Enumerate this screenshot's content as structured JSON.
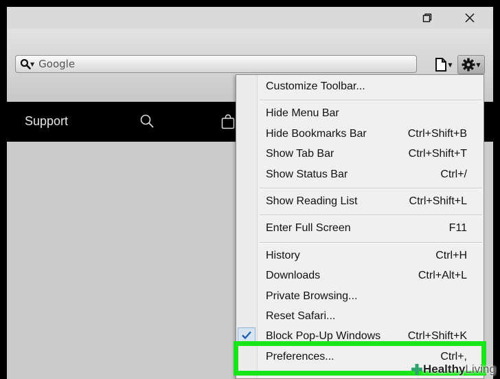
{
  "window": {
    "controls": {
      "restore_glyph": "❐",
      "close_glyph": "✕"
    }
  },
  "search": {
    "placeholder": "Google",
    "engine_icon": "search-icon"
  },
  "toolbar": {
    "page_icon": "page-icon",
    "settings_icon": "gear-icon"
  },
  "site_nav": {
    "support_label": "Support",
    "search_icon": "search-icon",
    "bag_icon": "shopping-bag-icon"
  },
  "menu": {
    "groups": [
      [
        {
          "label": "Customize Toolbar...",
          "shortcut": ""
        }
      ],
      [
        {
          "label": "Hide Menu Bar",
          "shortcut": ""
        },
        {
          "label": "Hide Bookmarks Bar",
          "shortcut": "Ctrl+Shift+B"
        },
        {
          "label": "Show Tab Bar",
          "shortcut": "Ctrl+Shift+T"
        },
        {
          "label": "Show Status Bar",
          "shortcut": "Ctrl+/"
        }
      ],
      [
        {
          "label": "Show Reading List",
          "shortcut": "Ctrl+Shift+L"
        }
      ],
      [
        {
          "label": "Enter Full Screen",
          "shortcut": "F11"
        }
      ],
      [
        {
          "label": "History",
          "shortcut": "Ctrl+H"
        },
        {
          "label": "Downloads",
          "shortcut": "Ctrl+Alt+L"
        },
        {
          "label": "Private Browsing...",
          "shortcut": ""
        },
        {
          "label": "Reset Safari...",
          "shortcut": ""
        },
        {
          "label": "Block Pop-Up Windows",
          "shortcut": "Ctrl+Shift+K",
          "checked": true
        },
        {
          "label": "Preferences...",
          "shortcut": "Ctrl+,"
        }
      ]
    ]
  },
  "highlight_color": "#19e619",
  "watermark": {
    "bold": "Healthy",
    "normal": " Living"
  }
}
